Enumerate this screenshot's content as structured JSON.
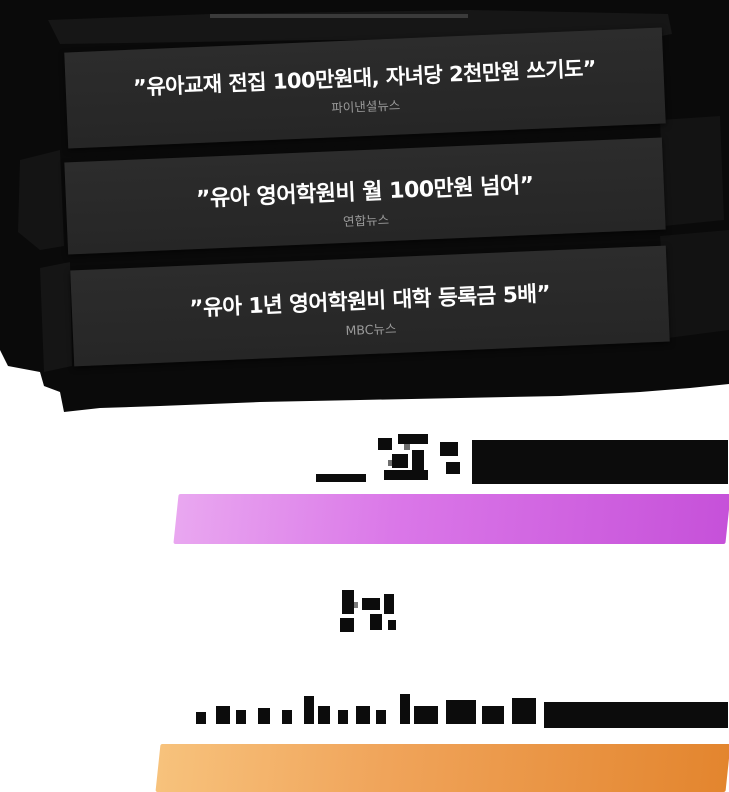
{
  "headlines": [
    {
      "text": "”유아교재 전집 100만원대, 자녀당 2천만원 쓰기도”",
      "source": "파이낸셜뉴스"
    },
    {
      "text": "”유아 영어학원비 월 100만원 넘어”",
      "source": "연합뉴스"
    },
    {
      "text": "”유아 1년 영어학원비 대학 등록금 5배”",
      "source": "MBC뉴스"
    }
  ],
  "colors": {
    "backdrop": "#0a0a0a",
    "card": "#2a2a2a",
    "violet_highlight": "#d67ae6",
    "orange_highlight": "#ee9d4f"
  }
}
